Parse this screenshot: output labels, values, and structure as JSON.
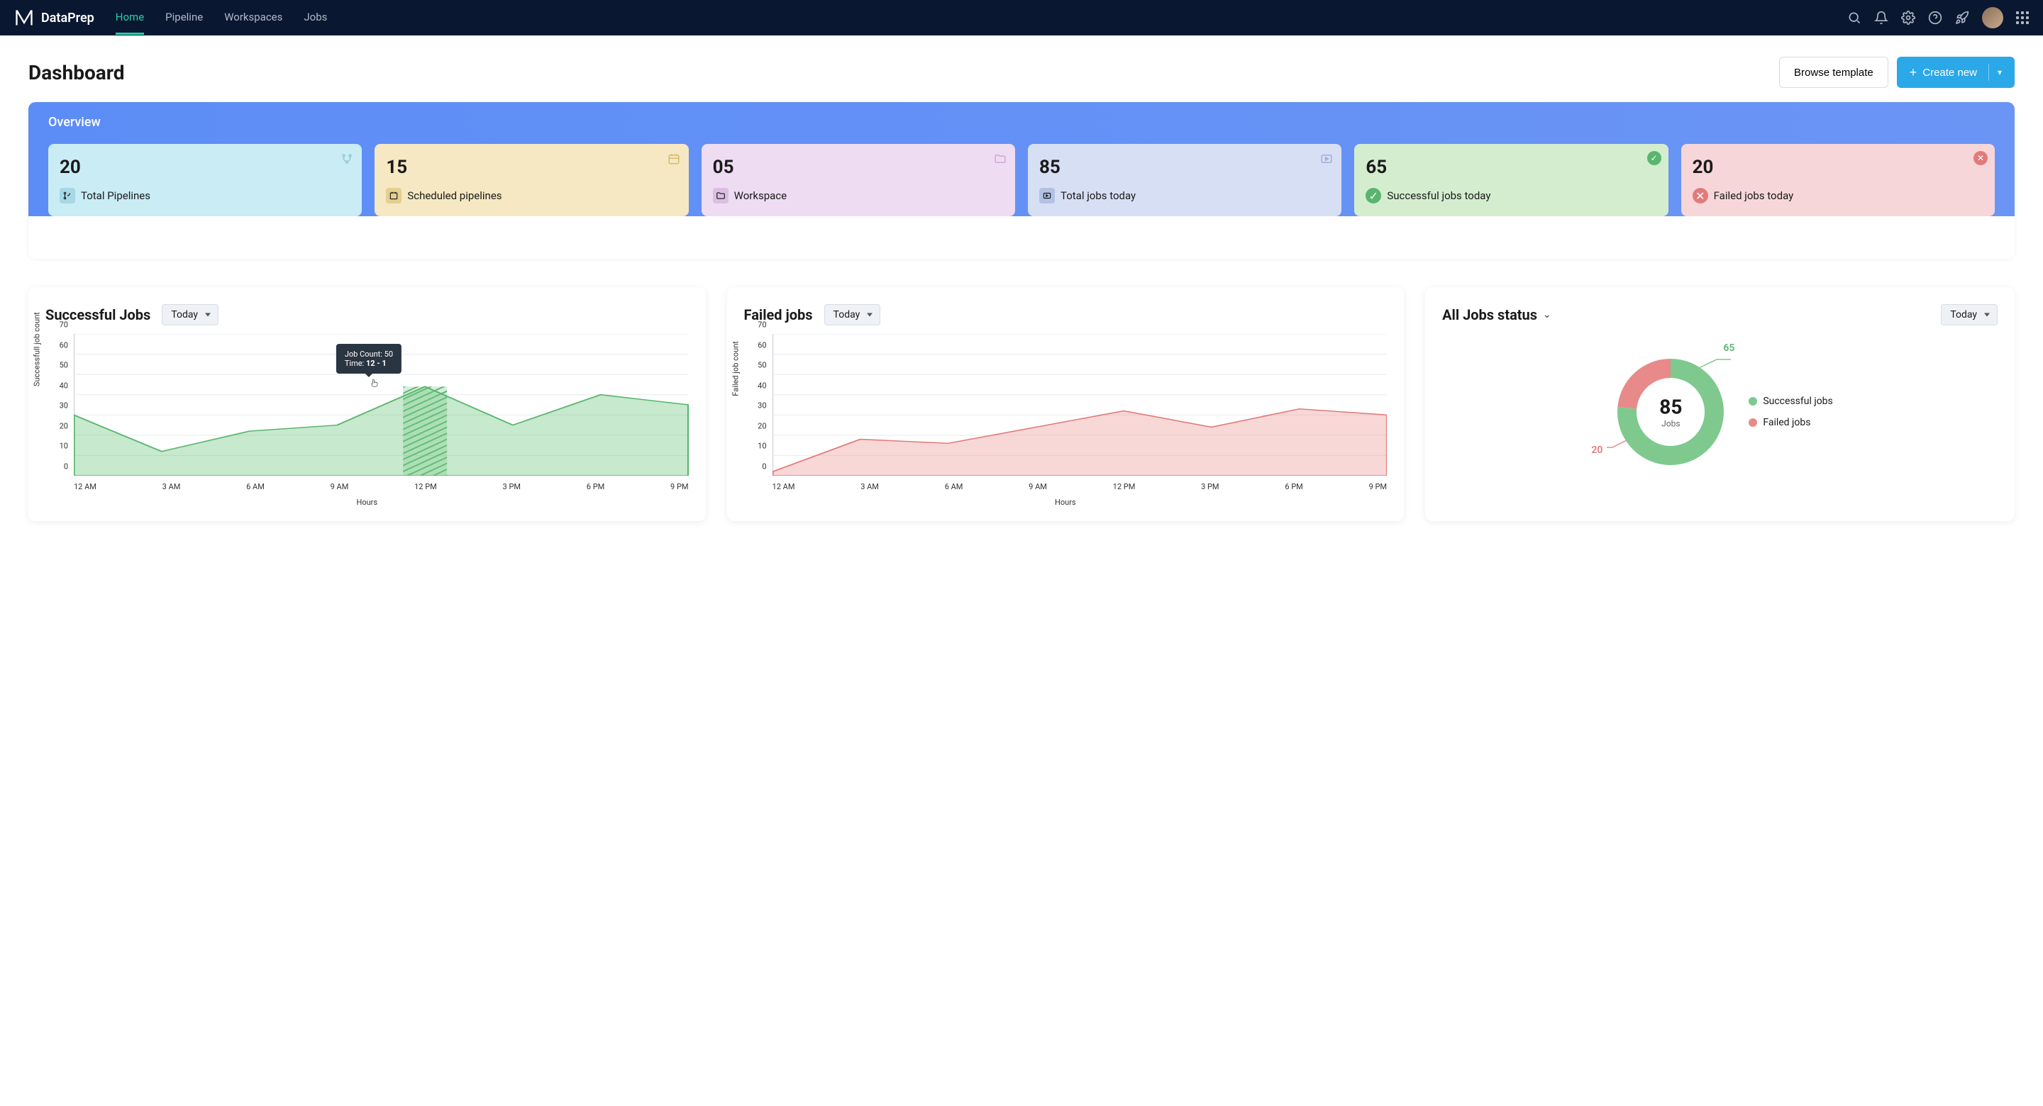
{
  "app": {
    "name": "DataPrep"
  },
  "nav": {
    "items": [
      {
        "label": "Home",
        "active": true
      },
      {
        "label": "Pipeline",
        "active": false
      },
      {
        "label": "Workspaces",
        "active": false
      },
      {
        "label": "Jobs",
        "active": false
      }
    ]
  },
  "page": {
    "title": "Dashboard",
    "browse_label": "Browse template",
    "create_label": "Create new"
  },
  "overview": {
    "title": "Overview",
    "cards": [
      {
        "value": "20",
        "label": "Total Pipelines"
      },
      {
        "value": "15",
        "label": "Scheduled pipelines"
      },
      {
        "value": "05",
        "label": "Workspace"
      },
      {
        "value": "85",
        "label": "Total jobs today"
      },
      {
        "value": "65",
        "label": "Successful jobs today"
      },
      {
        "value": "20",
        "label": "Failed jobs today"
      }
    ]
  },
  "successful": {
    "title": "Successful Jobs",
    "range": "Today",
    "ylabel": "Successfull job count",
    "xlabel": "Hours",
    "tooltip_count_label": "Job Count:",
    "tooltip_count_value": "50",
    "tooltip_time_label": "Time:",
    "tooltip_time_value": "12 - 1"
  },
  "failed": {
    "title": "Failed jobs",
    "range": "Today",
    "ylabel": "Failed job count",
    "xlabel": "Hours"
  },
  "alljobs": {
    "title": "All Jobs status",
    "range": "Today",
    "center_value": "85",
    "center_label": "Jobs",
    "success_callout": "65",
    "failed_callout": "20",
    "legend_success": "Successful jobs",
    "legend_failed": "Failed jobs"
  },
  "chart_data": [
    {
      "type": "area",
      "name": "successful_jobs",
      "title": "Successful Jobs",
      "xlabel": "Hours",
      "ylabel": "Successfull job count",
      "ylim": [
        0,
        70
      ],
      "categories": [
        "12 AM",
        "3 AM",
        "6 AM",
        "9 AM",
        "12 PM",
        "3 PM",
        "6 PM",
        "9 PM"
      ],
      "values": [
        30,
        12,
        22,
        25,
        44,
        25,
        40,
        35
      ],
      "highlight": {
        "x": "12 PM",
        "value": 44,
        "tooltip": {
          "job_count": 50,
          "time": "12 - 1"
        }
      }
    },
    {
      "type": "area",
      "name": "failed_jobs",
      "title": "Failed jobs",
      "xlabel": "Hours",
      "ylabel": "Failed job count",
      "ylim": [
        0,
        70
      ],
      "categories": [
        "12 AM",
        "3 AM",
        "6 AM",
        "9 AM",
        "12 PM",
        "3 PM",
        "6 PM",
        "9 PM"
      ],
      "values": [
        2,
        18,
        16,
        24,
        32,
        24,
        33,
        30
      ]
    },
    {
      "type": "pie",
      "name": "all_jobs_status",
      "title": "All Jobs status",
      "series": [
        {
          "name": "Successful jobs",
          "value": 65,
          "color": "#7fc98f"
        },
        {
          "name": "Failed jobs",
          "value": 20,
          "color": "#e88a8a"
        }
      ],
      "total_label": "Jobs",
      "total_value": 85
    }
  ]
}
